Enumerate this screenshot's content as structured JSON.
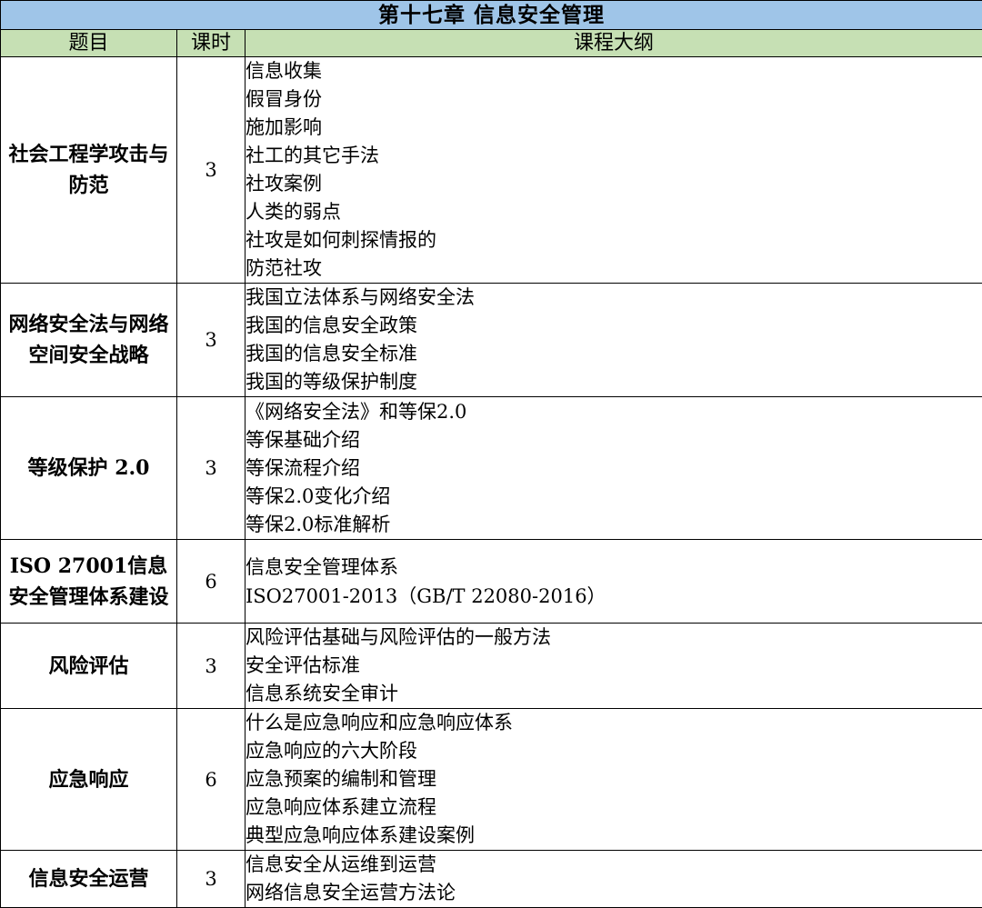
{
  "title": "第十七章 信息安全管理",
  "headers": {
    "topic": "题目",
    "hours": "课时",
    "outline": "课程大纲"
  },
  "rows": [
    {
      "topic": "社会工程学攻击与防范",
      "hours": "3",
      "outline": [
        "信息收集",
        "假冒身份",
        "施加影响",
        "社工的其它手法",
        "社攻案例",
        "人类的弱点",
        "社攻是如何刺探情报的",
        "防范社攻"
      ]
    },
    {
      "topic": "网络安全法与网络空间安全战略",
      "hours": "3",
      "outline": [
        "我国立法体系与网络安全法",
        "我国的信息安全政策",
        "我国的信息安全标准",
        "我国的等级保护制度"
      ]
    },
    {
      "topic": "等级保护 2.0",
      "hours": "3",
      "outline": [
        "《网络安全法》和等保2.0",
        "等保基础介绍",
        "等保流程介绍",
        "等保2.0变化介绍",
        "等保2.0标准解析"
      ]
    },
    {
      "topic": "ISO 27001信息安全管理体系建设",
      "hours": "6",
      "outline": [
        "信息安全管理体系",
        "ISO27001-2013（GB/T 22080-2016）"
      ]
    },
    {
      "topic": "风险评估",
      "hours": "3",
      "outline": [
        "风险评估基础与风险评估的一般方法",
        "安全评估标准",
        "信息系统安全审计"
      ]
    },
    {
      "topic": "应急响应",
      "hours": "6",
      "outline": [
        "什么是应急响应和应急响应体系",
        "应急响应的六大阶段",
        "应急预案的编制和管理",
        "应急响应体系建立流程",
        "典型应急响应体系建设案例"
      ]
    },
    {
      "topic": "信息安全运营",
      "hours": "3",
      "outline": [
        "信息安全从运维到运营",
        "网络信息安全运营方法论"
      ]
    }
  ]
}
